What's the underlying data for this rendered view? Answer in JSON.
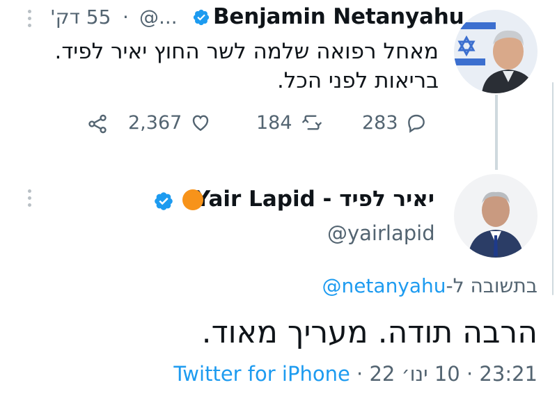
{
  "tweet1": {
    "author_name": "Benjamin Netanyahu",
    "handle": "@...",
    "separator": "·",
    "time": "55 דק'",
    "text_line1": "מאחל רפואה שלמה לשר החוץ יאיר לפיד.",
    "text_line2": "בריאות לפני הכל.",
    "reply_count": "283",
    "retweet_count": "184",
    "like_count": "2,367"
  },
  "tweet2": {
    "author_name": "Yair Lapid - יאיר לפיד",
    "handle": "@yairlapid",
    "reply_prefix": "בתשובה ל-",
    "reply_to": "@netanyahu",
    "text": "הרבה תודה. מעריך מאוד.",
    "time": "23:21",
    "date": "10 ינו׳ 22",
    "source": "Twitter for iPhone",
    "separator": "·"
  },
  "colors": {
    "accent": "#1d9bf0",
    "muted": "#536471",
    "orange_dot": "#f7931a"
  },
  "icons": [
    "kebab-menu-icon",
    "verified-badge-icon",
    "reply-icon",
    "retweet-icon",
    "like-icon",
    "share-icon"
  ]
}
